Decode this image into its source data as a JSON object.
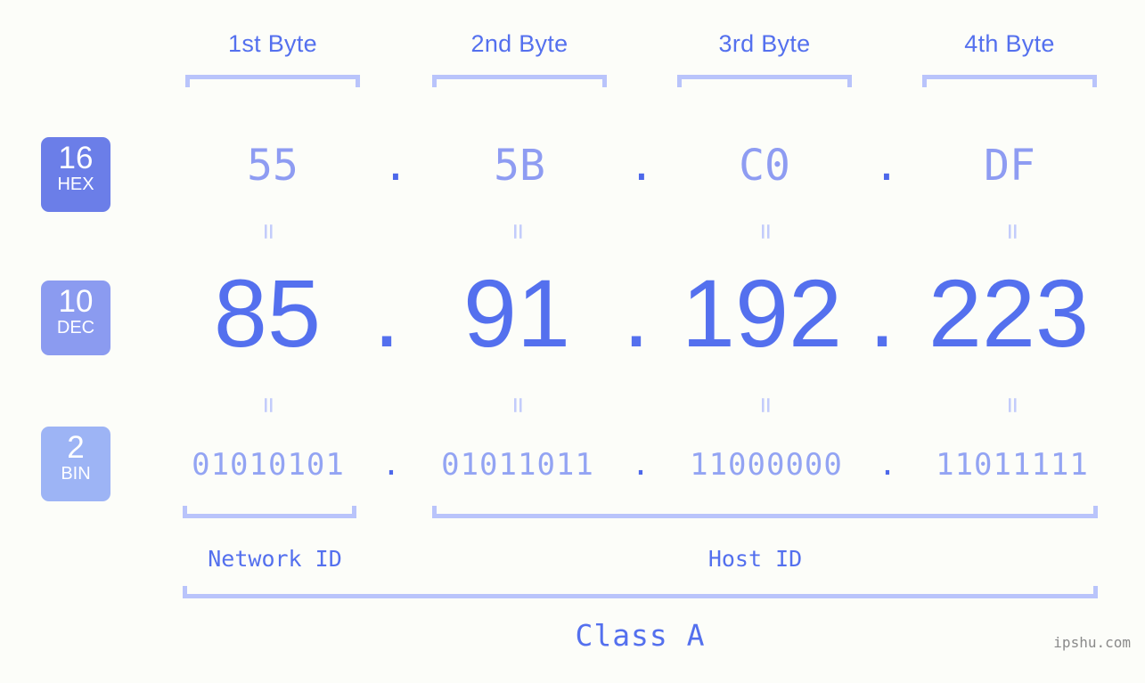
{
  "diagram": {
    "ip_address": "85.91.192.223",
    "background_color": "#fcfdf9",
    "accent_color": "#5470ee",
    "bracket_color": "#b9c4fb"
  },
  "byte_headers": [
    {
      "label": "1st Byte"
    },
    {
      "label": "2nd Byte"
    },
    {
      "label": "3rd Byte"
    },
    {
      "label": "4th Byte"
    }
  ],
  "bases": [
    {
      "number": "16",
      "name": "HEX",
      "color": "#6b7ee8"
    },
    {
      "number": "10",
      "name": "DEC",
      "color": "#8b9bf0"
    },
    {
      "number": "2",
      "name": "BIN",
      "color": "#9db4f5"
    }
  ],
  "rows": {
    "hex": {
      "octets": [
        "55",
        "5B",
        "C0",
        "DF"
      ],
      "separator": "."
    },
    "dec": {
      "octets": [
        "85",
        "91",
        "192",
        "223"
      ],
      "separator": "."
    },
    "bin": {
      "octets": [
        "01010101",
        "01011011",
        "11000000",
        "11011111"
      ],
      "separator": "."
    }
  },
  "equals_sign": "=",
  "segments": [
    {
      "label": "Network ID"
    },
    {
      "label": "Host ID"
    }
  ],
  "class": {
    "label": "Class A"
  },
  "watermark": {
    "text": "ipshu.com"
  }
}
